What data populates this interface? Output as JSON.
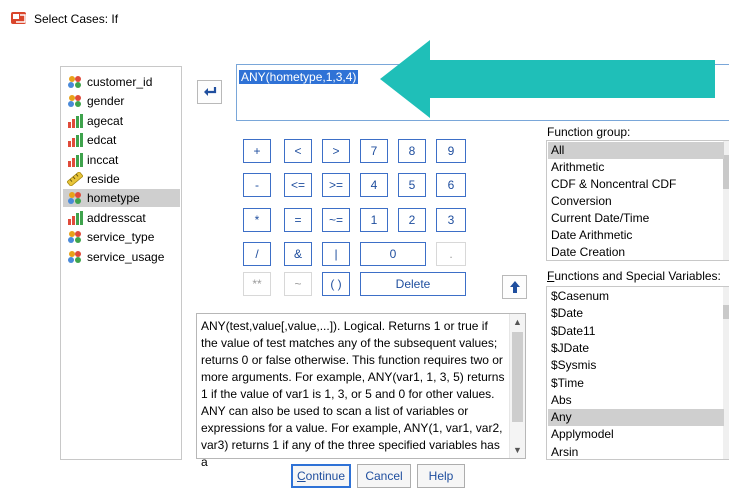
{
  "window": {
    "title": "Select Cases: If"
  },
  "variables": [
    {
      "label": "customer_id",
      "icon": "nominal-icon",
      "selected": false
    },
    {
      "label": "gender",
      "icon": "nominal-icon",
      "selected": false
    },
    {
      "label": "agecat",
      "icon": "ordinal-icon",
      "selected": false
    },
    {
      "label": "edcat",
      "icon": "ordinal-icon",
      "selected": false
    },
    {
      "label": "inccat",
      "icon": "ordinal-icon",
      "selected": false
    },
    {
      "label": "reside",
      "icon": "scale-icon",
      "selected": false
    },
    {
      "label": "hometype",
      "icon": "nominal-icon",
      "selected": true
    },
    {
      "label": "addresscat",
      "icon": "ordinal-icon",
      "selected": false
    },
    {
      "label": "service_type",
      "icon": "nominal-icon",
      "selected": false
    },
    {
      "label": "service_usage",
      "icon": "nominal-icon",
      "selected": false
    }
  ],
  "expression": {
    "value": "ANY(hometype,1,3,4)"
  },
  "keypad": {
    "keys": [
      "+",
      "<",
      ">",
      "7",
      "8",
      "9",
      "-",
      "<=",
      ">=",
      "4",
      "5",
      "6",
      "*",
      "=",
      "~=",
      "1",
      "2",
      "3",
      "/",
      "&",
      "|",
      "0",
      ".",
      "**",
      "~",
      "( )",
      "Delete"
    ]
  },
  "description": {
    "text": "ANY(test,value[,value,...]). Logical. Returns 1 or true if the value of test matches any of the subsequent values; returns 0 or false otherwise. This function requires two or more arguments. For example, ANY(var1, 1, 3, 5) returns 1 if the value of var1 is 1, 3, or 5 and 0 for other values. ANY can also be used to scan a list of variables or expressions for a value. For example, ANY(1, var1, var2, var3) returns 1 if any of the three specified variables has a"
  },
  "function_group": {
    "label": "Function group:",
    "items": [
      "All",
      "Arithmetic",
      "CDF & Noncentral CDF",
      "Conversion",
      "Current Date/Time",
      "Date Arithmetic",
      "Date Creation"
    ],
    "selected": "All"
  },
  "functions": {
    "label_first": "F",
    "label_rest": "unctions and Special Variables:",
    "items": [
      "$Casenum",
      "$Date",
      "$Date11",
      "$JDate",
      "$Sysmis",
      "$Time",
      "Abs",
      "Any",
      "Applymodel",
      "Arsin"
    ],
    "selected": "Any"
  },
  "buttons": {
    "continue_first": "C",
    "continue_rest": "ontinue",
    "cancel": "Cancel",
    "help": "Help"
  },
  "colors": {
    "accent": "#2f72d6",
    "annotation_arrow": "#1fbfb8",
    "selection": "#cfcfcf"
  }
}
